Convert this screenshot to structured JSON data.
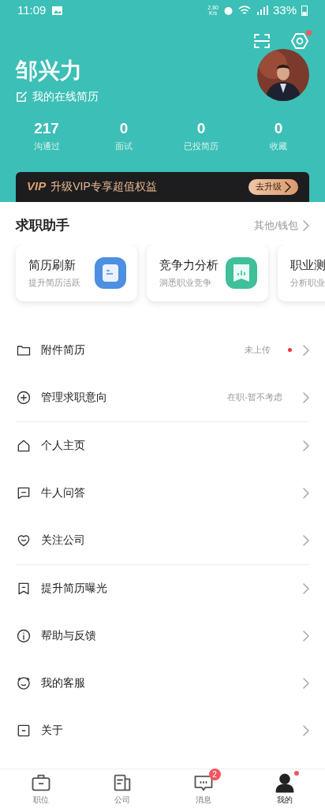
{
  "status_bar": {
    "time": "11:09",
    "speed": "2.80\nK/s",
    "battery": "33%"
  },
  "profile": {
    "name": "邹兴力",
    "resume_link": "我的在线简历",
    "settings_badge": true
  },
  "stats": [
    {
      "value": "217",
      "label": "沟通过"
    },
    {
      "value": "0",
      "label": "面试"
    },
    {
      "value": "0",
      "label": "已投简历"
    },
    {
      "value": "0",
      "label": "收藏"
    }
  ],
  "vip_banner": {
    "logo": "VIP",
    "text": "升级VIP专享超值权益",
    "button": "去升级"
  },
  "assistant": {
    "title": "求职助手",
    "link": "其他/钱包",
    "cards": [
      {
        "title": "简历刷新",
        "subtitle": "提升简历活跃",
        "kind": "document"
      },
      {
        "title": "竞争力分析",
        "subtitle": "洞悉职业竞争",
        "kind": "chart"
      },
      {
        "title": "职业测",
        "subtitle": "分析职业",
        "kind": "none"
      }
    ]
  },
  "menu_groups": [
    [
      {
        "label": "附件简历",
        "value": "未上传",
        "dot": true,
        "kind": "folder"
      },
      {
        "label": "管理求职意向",
        "value": "在职-暂不考虑",
        "dot": false,
        "kind": "plus"
      }
    ],
    [
      {
        "label": "个人主页",
        "dot": false,
        "kind": "home"
      },
      {
        "label": "牛人问答",
        "dot": false,
        "kind": "chat"
      },
      {
        "label": "关注公司",
        "dot": false,
        "kind": "heart"
      }
    ],
    [
      {
        "label": "提升简历曝光",
        "dot": false,
        "kind": "bookmark"
      },
      {
        "label": "帮助与反馈",
        "dot": false,
        "kind": "info"
      },
      {
        "label": "我的客服",
        "dot": false,
        "kind": "smile"
      },
      {
        "label": "关于",
        "dot": false,
        "kind": "square"
      }
    ]
  ],
  "bottom_nav": [
    {
      "label": "职位",
      "selected": false,
      "kind": "briefcase"
    },
    {
      "label": "公司",
      "selected": false,
      "kind": "building"
    },
    {
      "label": "消息",
      "selected": false,
      "kind": "message",
      "badge": "2"
    },
    {
      "label": "我的",
      "selected": true,
      "kind": "person",
      "dot": true
    }
  ]
}
